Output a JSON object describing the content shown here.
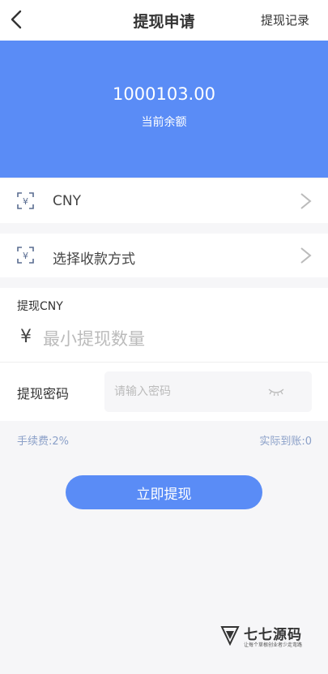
{
  "header": {
    "title": "提现申请",
    "record_link": "提现记录"
  },
  "balance": {
    "amount": "1000103.00",
    "label": "当前余额"
  },
  "currency_row": {
    "icon": "scan-yen-icon",
    "label": "CNY"
  },
  "method_row": {
    "icon": "scan-yen-icon",
    "label": "选择收款方式"
  },
  "form": {
    "amount_label": "提现CNY",
    "currency_symbol": "¥",
    "amount_placeholder": "最小提现数量",
    "password_label": "提现密码",
    "password_placeholder": "请输入密码"
  },
  "fees": {
    "fee_text": "手续费:2%",
    "received_text": "实际到账:0"
  },
  "submit_label": "立即提现",
  "watermark": {
    "name": "七七源码",
    "slogan": "让每个草根创业者少走弯路"
  },
  "colors": {
    "accent": "#5a8cf6",
    "background": "#f6f6f8",
    "muted_text": "#8ba0c8"
  }
}
